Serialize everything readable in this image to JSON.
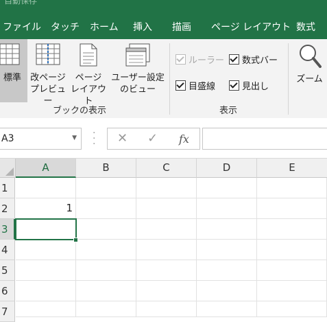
{
  "titlebar": {
    "title": "自動保存"
  },
  "tabs": [
    "ファイル",
    "タッチ",
    "ホーム",
    "挿入",
    "描画",
    "ページ レイアウト",
    "数式"
  ],
  "ribbon": {
    "book_views": [
      {
        "line1": "標準",
        "line2": ""
      },
      {
        "line1": "改ページ",
        "line2": "プレビュー"
      },
      {
        "line1": "ページ",
        "line2": "レイアウト"
      },
      {
        "line1": "ユーザー設定",
        "line2": "のビュー"
      }
    ],
    "book_views_group": "ブックの表示",
    "show": {
      "ruler": "ルーラー",
      "formula_bar": "数式バー",
      "gridlines": "目盛線",
      "headings": "見出し"
    },
    "show_group": "表示",
    "zoom": "ズーム"
  },
  "formula_bar": {
    "name_box": "A3",
    "cancel": "✕",
    "enter": "✓",
    "fx": "fx",
    "value": ""
  },
  "sheet": {
    "columns": [
      "A",
      "B",
      "C",
      "D",
      "E"
    ],
    "rows": [
      "1",
      "2",
      "3",
      "4",
      "5",
      "6",
      "7"
    ],
    "cells": {
      "A2": "1"
    },
    "selected": "A3"
  },
  "colors": {
    "accent": "#217346"
  }
}
